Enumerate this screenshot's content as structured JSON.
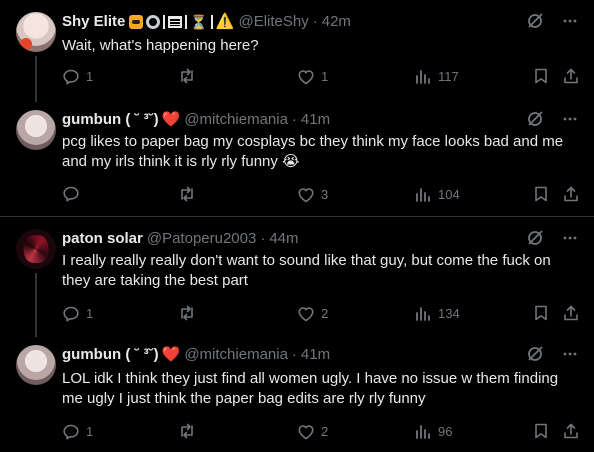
{
  "tweets": [
    {
      "name": "Shy Elite",
      "handle": "@EliteShy",
      "time": "42m",
      "text": "Wait, what's happening here?",
      "replies": "1",
      "reposts": "",
      "likes": "1",
      "views": "117"
    },
    {
      "name": "gumbun ( ˘ ³˘)",
      "handle": "@mitchiemania",
      "time": "41m",
      "text": "pcg likes to paper bag my cosplays bc they think my face looks bad and me and my irls think it is rly rly funny 😭",
      "replies": "",
      "reposts": "",
      "likes": "3",
      "views": "104"
    },
    {
      "name": "paton solar",
      "handle": "@Patoperu2003",
      "time": "44m",
      "text": "I really really really don't want to sound like that guy, but come the fuck on they are taking the best part",
      "replies": "1",
      "reposts": "",
      "likes": "2",
      "views": "134"
    },
    {
      "name": "gumbun ( ˘ ³˘)",
      "handle": "@mitchiemania",
      "time": "41m",
      "text": "LOL idk I think they just find all women ugly. I have no issue w them finding me ugly I just think the paper bag edits are rly rly funny",
      "replies": "1",
      "reposts": "",
      "likes": "2",
      "views": "96"
    }
  ],
  "separator": "·",
  "heart_emoji": "❤️",
  "icons": {
    "reply": "reply-icon",
    "repost": "repost-icon",
    "like": "like-icon",
    "views": "views-icon",
    "bookmark": "bookmark-icon",
    "share": "share-icon",
    "grok": "grok-icon",
    "more": "more-icon"
  },
  "badge_emojis": [
    "🐯",
    "⚙️",
    "⏳",
    "⚠️"
  ],
  "colors": {
    "background": "#000000",
    "text": "#e7e9ea",
    "muted": "#71767b",
    "border": "#2f3336",
    "heart": "#f4212e"
  }
}
